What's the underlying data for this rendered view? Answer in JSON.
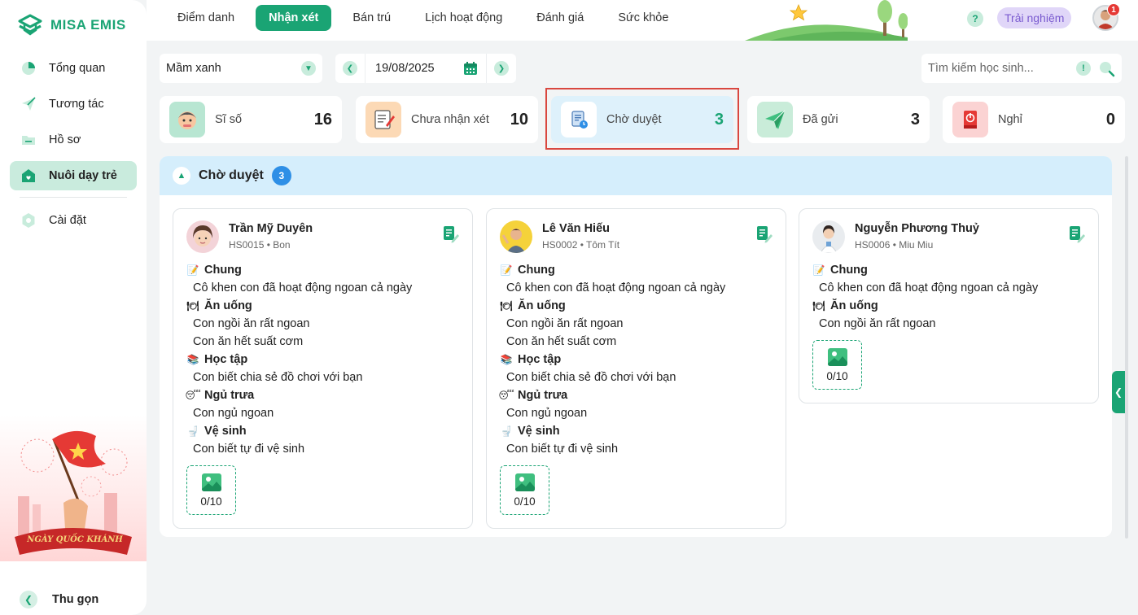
{
  "app": {
    "brand": "MISA EMIS"
  },
  "sidebar": {
    "items": [
      {
        "label": "Tổng quan",
        "icon": "pie-chart-icon"
      },
      {
        "label": "Tương tác",
        "icon": "paper-plane-icon"
      },
      {
        "label": "Hồ sơ",
        "icon": "folder-icon"
      },
      {
        "label": "Nuôi dạy trẻ",
        "icon": "home-heart-icon",
        "active": true
      },
      {
        "label": "Cài đặt",
        "icon": "gear-icon"
      }
    ],
    "banner_text": "NGÀY QUỐC KHÁNH",
    "collapse_label": "Thu gọn"
  },
  "topbar": {
    "tabs": [
      "Điểm danh",
      "Nhận xét",
      "Bán trú",
      "Lịch hoạt động",
      "Đánh giá",
      "Sức khỏe"
    ],
    "active_tab": "Nhận xét",
    "help": "?",
    "trial_label": "Trải nghiệm",
    "notification_count": "1"
  },
  "filters": {
    "class_value": "Mầm xanh",
    "date_value": "19/08/2025",
    "search_placeholder": "Tìm kiếm học sinh...",
    "search_help": "!"
  },
  "stats": [
    {
      "label": "Sĩ số",
      "value": "16"
    },
    {
      "label": "Chưa nhận xét",
      "value": "10"
    },
    {
      "label": "Chờ duyệt",
      "value": "3",
      "selected": true
    },
    {
      "label": "Đã gửi",
      "value": "3"
    },
    {
      "label": "Nghỉ",
      "value": "0"
    }
  ],
  "panel": {
    "title": "Chờ duyệt",
    "count": "3",
    "cards": [
      {
        "name": "Trần Mỹ Duyên",
        "sub": "HS0015 • Bon",
        "sections": [
          {
            "title": "Chung",
            "lines": [
              "Cô khen con đã hoạt động ngoan cả ngày"
            ]
          },
          {
            "title": "Ăn uống",
            "lines": [
              "Con ngồi ăn rất ngoan",
              "Con ăn hết suất cơm"
            ]
          },
          {
            "title": "Học tập",
            "lines": [
              "Con biết chia sẻ đồ chơi với bạn"
            ]
          },
          {
            "title": "Ngủ trưa",
            "lines": [
              "Con ngủ ngoan"
            ]
          },
          {
            "title": "Vệ sinh",
            "lines": [
              "Con biết tự đi vệ sinh"
            ]
          }
        ],
        "photos": "0/10"
      },
      {
        "name": "Lê Văn Hiếu",
        "sub": "HS0002 • Tôm Tít",
        "sections": [
          {
            "title": "Chung",
            "lines": [
              "Cô khen con đã hoạt động ngoan cả ngày"
            ]
          },
          {
            "title": "Ăn uống",
            "lines": [
              "Con ngồi ăn rất ngoan",
              "Con ăn hết suất cơm"
            ]
          },
          {
            "title": "Học tập",
            "lines": [
              "Con biết chia sẻ đồ chơi với bạn"
            ]
          },
          {
            "title": "Ngủ trưa",
            "lines": [
              "Con ngủ ngoan"
            ]
          },
          {
            "title": "Vệ sinh",
            "lines": [
              "Con biết tự đi vệ sinh"
            ]
          }
        ],
        "photos": "0/10"
      },
      {
        "name": "Nguyễn Phương Thuỷ",
        "sub": "HS0006 • Miu Miu",
        "sections": [
          {
            "title": "Chung",
            "lines": [
              "Cô khen con đã hoạt động ngoan cả ngày"
            ]
          },
          {
            "title": "Ăn uống",
            "lines": [
              "Con ngồi ăn rất ngoan"
            ]
          }
        ],
        "photos": "0/10"
      }
    ]
  },
  "colors": {
    "brand": "#1aa474",
    "selected_card": "#def1fb",
    "highlight_border": "#d9473f",
    "badge": "#2e8fe6"
  }
}
